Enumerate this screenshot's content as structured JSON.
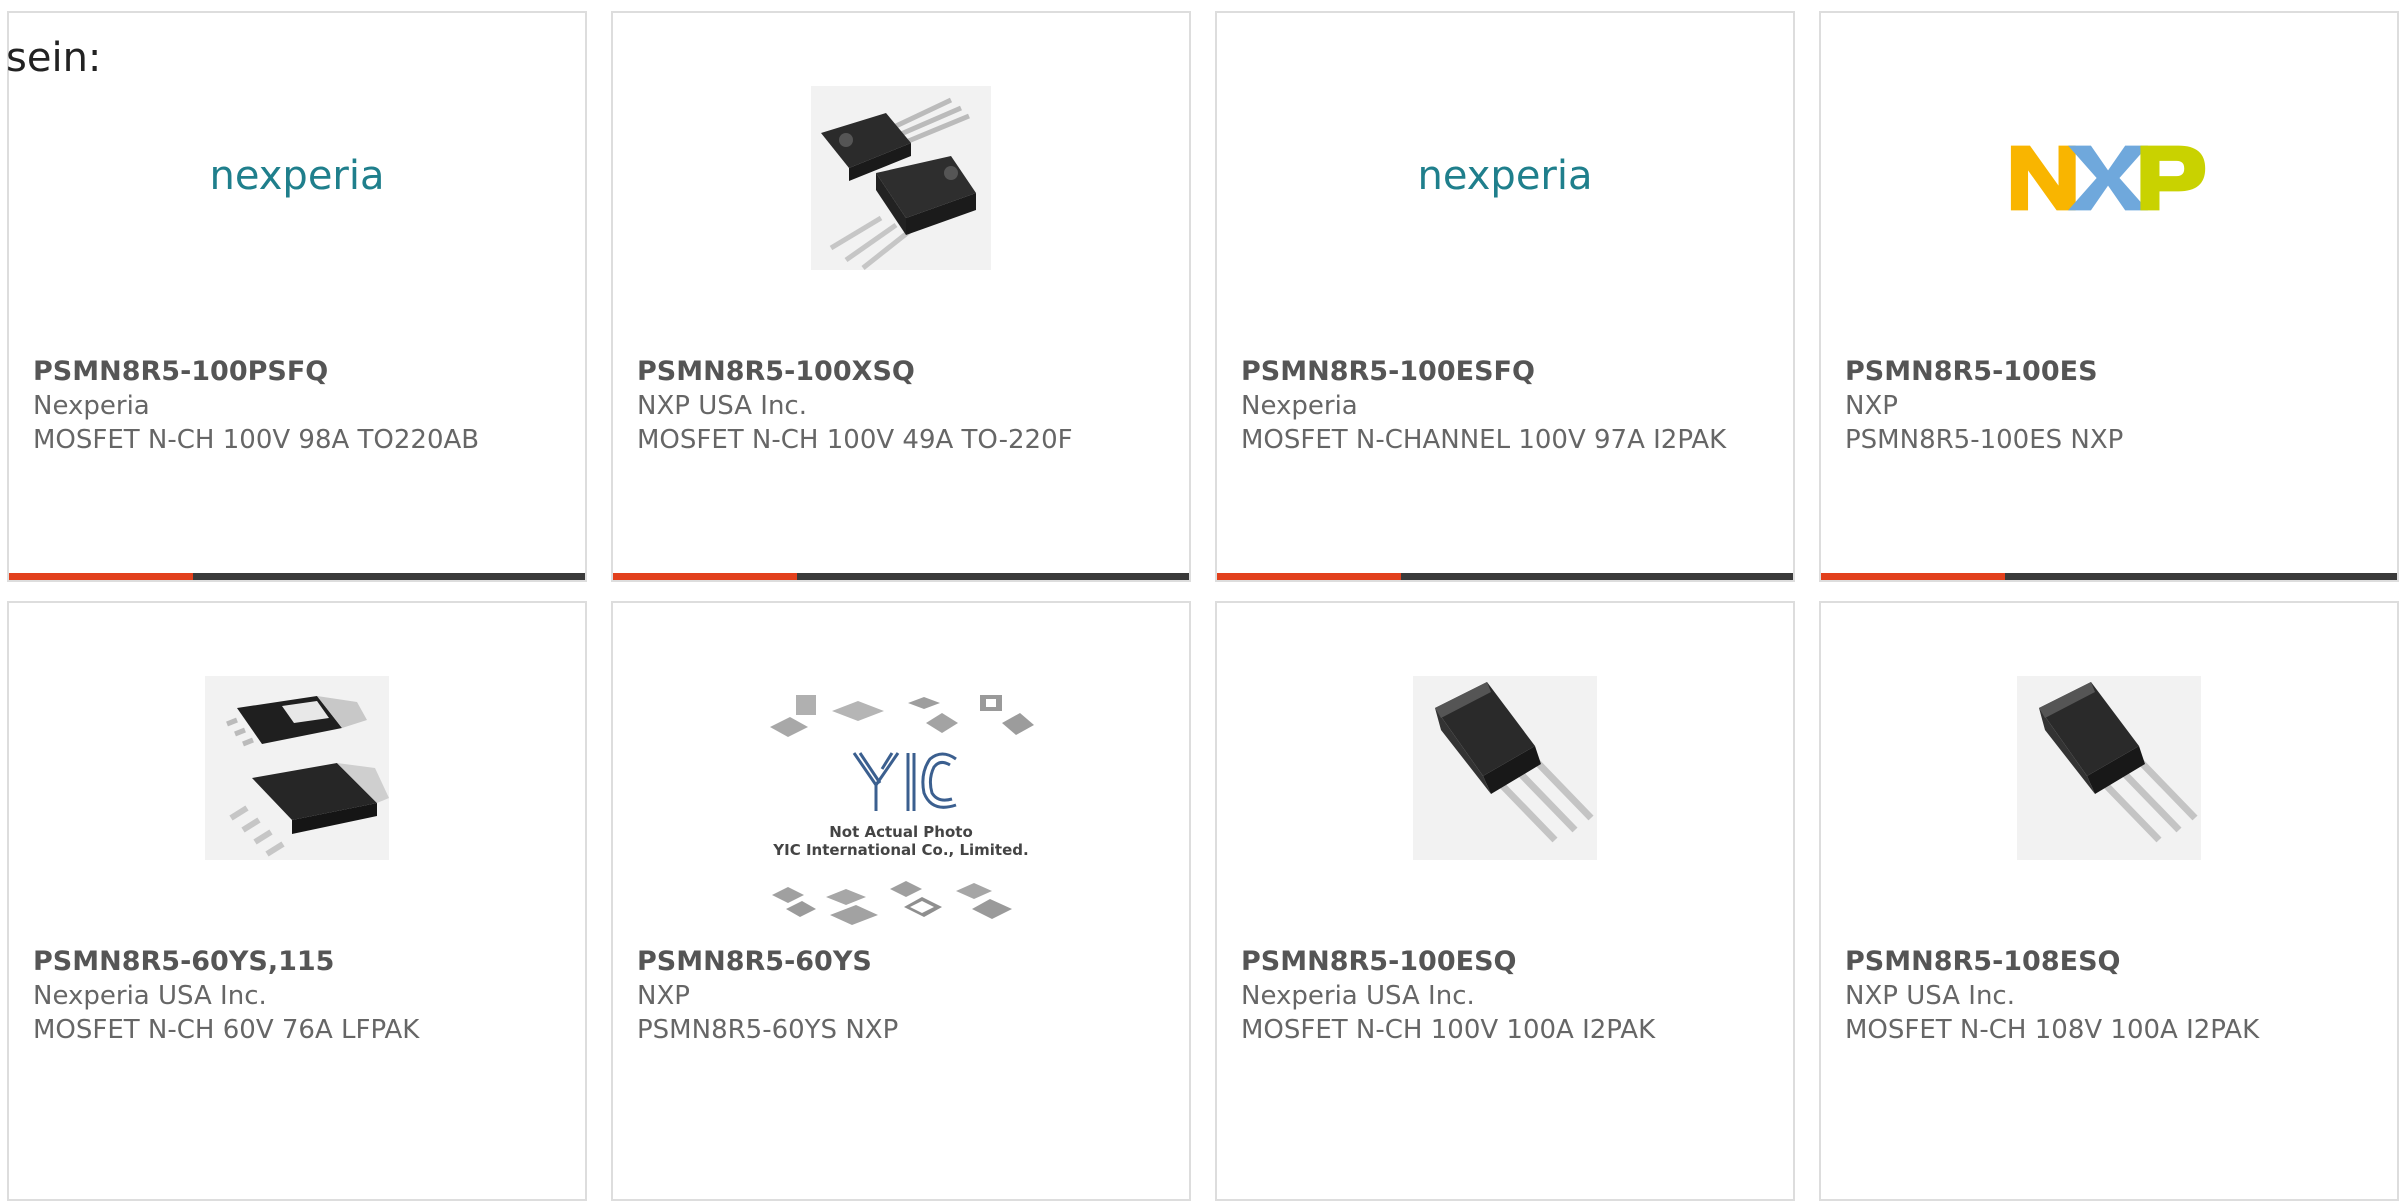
{
  "heading": "sein:",
  "cards": [
    {
      "part_number": "PSMN8R5-100PSFQ",
      "manufacturer": "Nexperia",
      "description": "MOSFET N-CH 100V 98A TO220AB",
      "image": "nexperia-logo",
      "logo_text": "nexperia",
      "progress": 0.32
    },
    {
      "part_number": "PSMN8R5-100XSQ",
      "manufacturer": "NXP USA Inc.",
      "description": "MOSFET N-CH 100V 49A TO-220F",
      "image": "to220f-package",
      "progress": 0.32
    },
    {
      "part_number": "PSMN8R5-100ESFQ",
      "manufacturer": "Nexperia",
      "description": "MOSFET N-CHANNEL 100V 97A I2PAK",
      "image": "nexperia-logo",
      "logo_text": "nexperia",
      "progress": 0.32
    },
    {
      "part_number": "PSMN8R5-100ES",
      "manufacturer": "NXP",
      "description": "PSMN8R5-100ES NXP",
      "image": "nxp-logo",
      "progress": 0.32
    },
    {
      "part_number": "PSMN8R5-60YS,115",
      "manufacturer": "Nexperia USA Inc.",
      "description": "MOSFET N-CH 60V 76A LFPAK",
      "image": "lfpak-package"
    },
    {
      "part_number": "PSMN8R5-60YS",
      "manufacturer": "NXP",
      "description": "PSMN8R5-60YS NXP",
      "image": "placeholder-photo",
      "placeholder_brand": "YIC",
      "placeholder_line1": "Not Actual Photo",
      "placeholder_line2": "YIC International Co., Limited."
    },
    {
      "part_number": "PSMN8R5-100ESQ",
      "manufacturer": "Nexperia USA Inc.",
      "description": "MOSFET N-CH 100V 100A I2PAK",
      "image": "i2pak-package"
    },
    {
      "part_number": "PSMN8R5-108ESQ",
      "manufacturer": "NXP USA Inc.",
      "description": "MOSFET N-CH 108V 100A I2PAK",
      "image": "i2pak-package"
    }
  ],
  "colors": {
    "accent": "#e2401c",
    "bar_dark": "#3a3a3a",
    "nexperia_teal": "#1f7f8c",
    "nexperia_orange": "#f08a24",
    "nxp_yellow": "#f9b500",
    "nxp_blue": "#6fa8dc",
    "nxp_green": "#c9d200"
  }
}
